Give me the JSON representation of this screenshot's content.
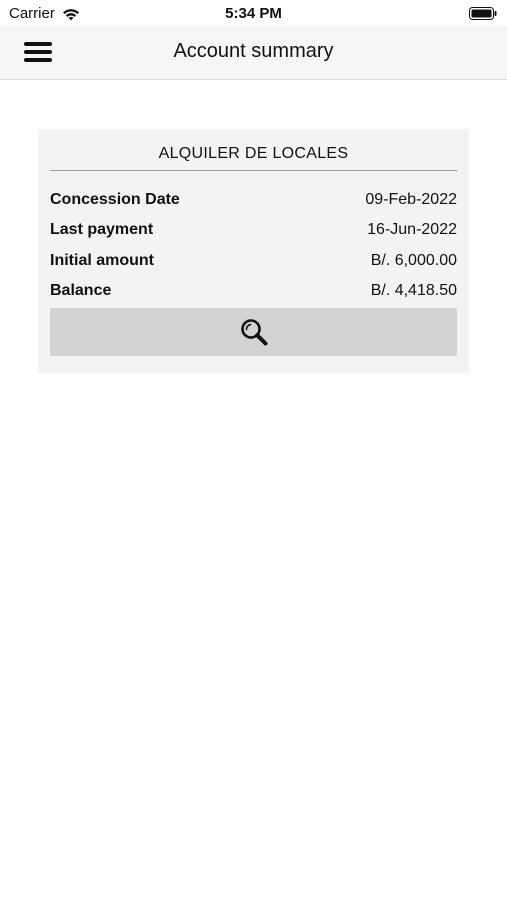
{
  "status_bar": {
    "carrier": "Carrier",
    "time": "5:34 PM",
    "wifi_icon": "wifi-icon",
    "battery_icon": "battery-icon"
  },
  "nav": {
    "menu_icon": "hamburger-menu-icon",
    "title": "Account summary"
  },
  "account_card": {
    "title": "ALQUILER DE LOCALES",
    "rows": [
      {
        "label": "Concession Date",
        "value": "09-Feb-2022"
      },
      {
        "label": "Last payment",
        "value": "16-Jun-2022"
      },
      {
        "label": "Initial amount",
        "value": "B/. 6,000.00"
      },
      {
        "label": "Balance",
        "value": "B/. 4,418.50"
      }
    ],
    "detail_button_icon": "magnifier-icon"
  },
  "colors": {
    "nav_background": "#f6f6f6",
    "card_background": "#f3f3f3",
    "button_background": "#d3d3d3",
    "text": "#111111"
  }
}
